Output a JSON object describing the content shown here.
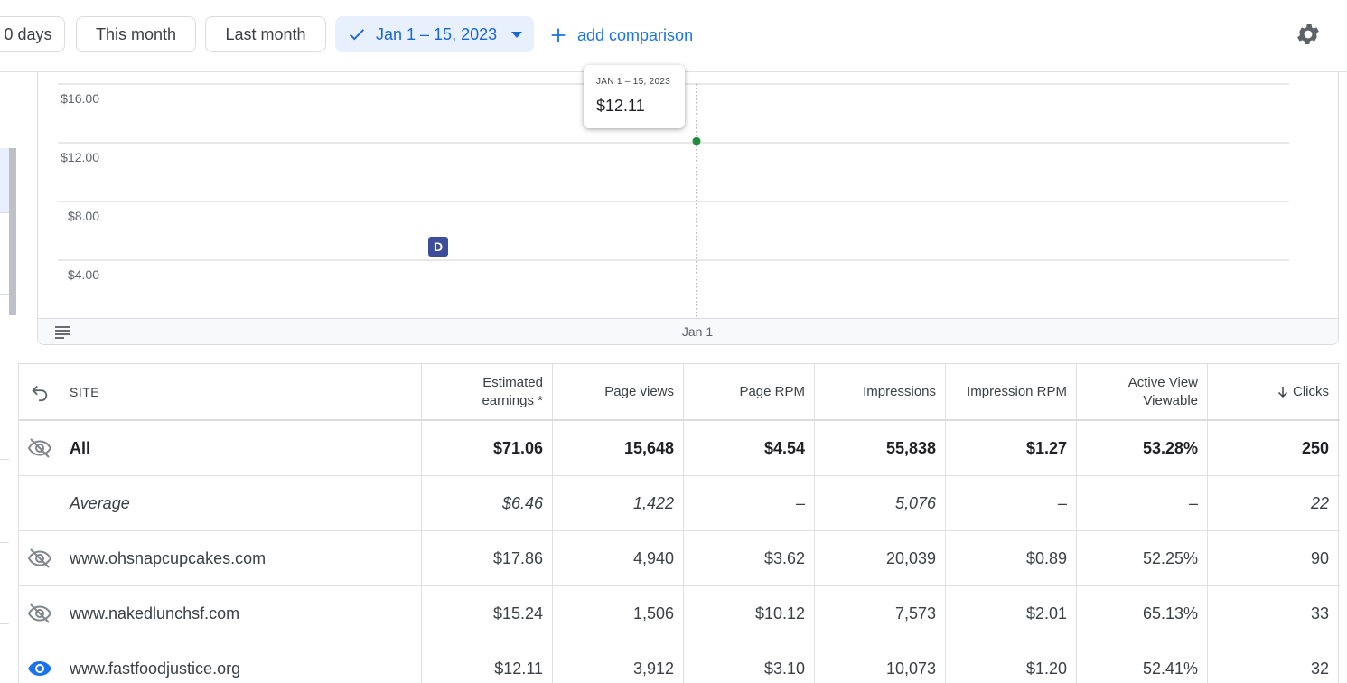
{
  "toolbar": {
    "chips": [
      {
        "label": "0 days"
      },
      {
        "label": "This month"
      },
      {
        "label": "Last month"
      }
    ],
    "selected_range": "Jan 1 – 15, 2023",
    "add_comparison": "add comparison",
    "colors": {
      "accent": "#1a73e8",
      "selected_bg": "#e8f0fe"
    }
  },
  "chart_data": {
    "type": "line",
    "ylabel_ticks": [
      "$16.00",
      "$12.00",
      "$8.00",
      "$4.00"
    ],
    "y_ticks": [
      16,
      12,
      8,
      4
    ],
    "categories": [
      "Jan 1"
    ],
    "series": [
      {
        "values": [
          12.11
        ]
      }
    ],
    "point_color": "#1e8e3e",
    "tooltip": {
      "range": "JAN 1 – 15, 2023",
      "value": "$12.11"
    },
    "annotation_label": "D"
  },
  "table": {
    "headers": {
      "site": "SITE",
      "earnings_line1": "Estimated",
      "earnings_line2": "earnings *",
      "page_views": "Page views",
      "page_rpm": "Page RPM",
      "impressions": "Impressions",
      "impression_rpm": "Impression RPM",
      "active_view_line1": "Active View",
      "active_view_line2": "Viewable",
      "clicks": "Clicks"
    },
    "total": {
      "site": "All",
      "earnings": "$71.06",
      "page_views": "15,648",
      "page_rpm": "$4.54",
      "impressions": "55,838",
      "impression_rpm": "$1.27",
      "active_view": "53.28%",
      "clicks": "250"
    },
    "average": {
      "site": "Average",
      "earnings": "$6.46",
      "page_views": "1,422",
      "page_rpm": "–",
      "impressions": "5,076",
      "impression_rpm": "–",
      "active_view": "–",
      "clicks": "22"
    },
    "rows": [
      {
        "site": "www.ohsnapcupcakes.com",
        "earnings": "$17.86",
        "page_views": "4,940",
        "page_rpm": "$3.62",
        "impressions": "20,039",
        "impression_rpm": "$0.89",
        "active_view": "52.25%",
        "clicks": "90",
        "visible": false
      },
      {
        "site": "www.nakedlunchsf.com",
        "earnings": "$15.24",
        "page_views": "1,506",
        "page_rpm": "$10.12",
        "impressions": "7,573",
        "impression_rpm": "$2.01",
        "active_view": "65.13%",
        "clicks": "33",
        "visible": false
      },
      {
        "site": "www.fastfoodjustice.org",
        "earnings": "$12.11",
        "page_views": "3,912",
        "page_rpm": "$3.10",
        "impressions": "10,073",
        "impression_rpm": "$1.20",
        "active_view": "52.41%",
        "clicks": "32",
        "visible": true
      }
    ]
  }
}
